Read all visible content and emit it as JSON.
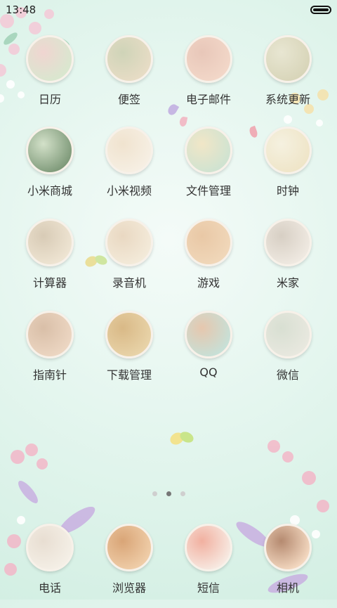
{
  "status": {
    "time": "13:48"
  },
  "apps": [
    {
      "label": "日历",
      "icon": "calendar-icon",
      "c1": "#d9e7cf",
      "c2": "#f0d5d1"
    },
    {
      "label": "便签",
      "icon": "notes-icon",
      "c1": "#e7dcc5",
      "c2": "#cfd4b8"
    },
    {
      "label": "电子邮件",
      "icon": "email-icon",
      "c1": "#f2d7c8",
      "c2": "#e8c7b9"
    },
    {
      "label": "系统更新",
      "icon": "update-icon",
      "c1": "#d8d5b9",
      "c2": "#e8e6d2"
    },
    {
      "label": "小米商城",
      "icon": "mall-icon",
      "c1": "#7f9a7a",
      "c2": "#d3e1c9"
    },
    {
      "label": "小米视频",
      "icon": "video-icon",
      "c1": "#f6efe3",
      "c2": "#f0e3cf"
    },
    {
      "label": "文件管理",
      "icon": "files-icon",
      "c1": "#cfe3d1",
      "c2": "#f1e6c7"
    },
    {
      "label": "时钟",
      "icon": "clock-icon",
      "c1": "#efe5c8",
      "c2": "#f5f1e0"
    },
    {
      "label": "计算器",
      "icon": "calculator-icon",
      "c1": "#eee4d2",
      "c2": "#d8cbb6"
    },
    {
      "label": "录音机",
      "icon": "recorder-icon",
      "c1": "#f3ead9",
      "c2": "#e9d8c2"
    },
    {
      "label": "游戏",
      "icon": "game-icon",
      "c1": "#f0d7b9",
      "c2": "#e9c8a6"
    },
    {
      "label": "米家",
      "icon": "mihome-icon",
      "c1": "#efe9e1",
      "c2": "#d7cfc4"
    },
    {
      "label": "指南针",
      "icon": "compass-icon",
      "c1": "#ecd6c2",
      "c2": "#d9bfa8"
    },
    {
      "label": "下载管理",
      "icon": "download-icon",
      "c1": "#e8d3a8",
      "c2": "#d9b987"
    },
    {
      "label": "QQ",
      "icon": "qq-icon",
      "c1": "#c7e0d7",
      "c2": "#e6c7ae"
    },
    {
      "label": "微信",
      "icon": "wechat-icon",
      "c1": "#e8e8df",
      "c2": "#d8dfd2"
    }
  ],
  "dock": [
    {
      "label": "电话",
      "icon": "phone-icon",
      "c1": "#f4efe6",
      "c2": "#e8ded2"
    },
    {
      "label": "浏览器",
      "icon": "browser-icon",
      "c1": "#efcda8",
      "c2": "#d9a577"
    },
    {
      "label": "短信",
      "icon": "sms-icon",
      "c1": "#f7e9e1",
      "c2": "#f1b0a0"
    },
    {
      "label": "相机",
      "icon": "camera-icon",
      "c1": "#f3d8c0",
      "c2": "#b58a70"
    }
  ],
  "pages": {
    "count": 3,
    "active": 1
  }
}
